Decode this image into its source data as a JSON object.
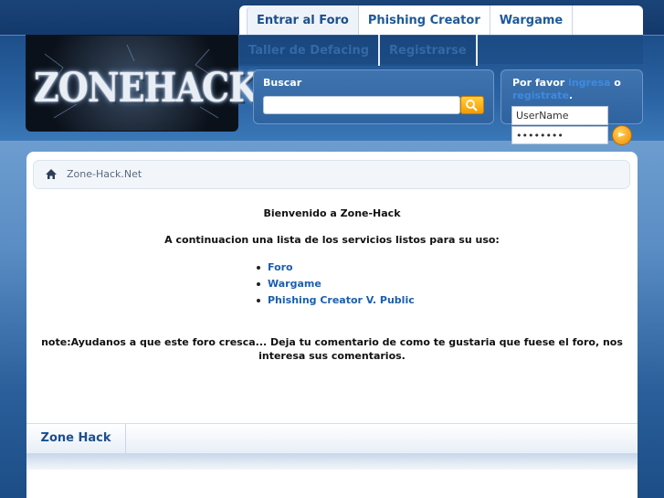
{
  "logo": {
    "text": "ZONEHACK"
  },
  "nav": {
    "row1": [
      "Entrar al Foro",
      "Phishing Creator",
      "Wargame"
    ],
    "row2": [
      "Taller de Defacing",
      "Registrarse"
    ]
  },
  "search": {
    "label": "Buscar",
    "value": ""
  },
  "login": {
    "prefix": "Por favor",
    "link1": "ingresa",
    "middle": "o",
    "link2": "registrate",
    "suffix": ".",
    "username_value": "UserName",
    "password_value": "••••••••"
  },
  "breadcrumb": {
    "home_icon": "home-icon",
    "text": "Zone-Hack.Net"
  },
  "main": {
    "welcome": "Bienvenido a Zone-Hack",
    "intro": "A continuacion una lista de los servicios listos para su uso:",
    "services": [
      "Foro",
      "Wargame",
      "Phishing Creator V. Public"
    ],
    "note": "note:Ayudanos a que este foro cresca... Deja tu comentario de como te gustaria que fuese el foro, nos interesa sus comentarios."
  },
  "footer": {
    "tab": "Zone Hack"
  },
  "colors": {
    "accent": "#1c5fad",
    "nav_text": "#1c4f8c",
    "button": "#f59b00"
  }
}
